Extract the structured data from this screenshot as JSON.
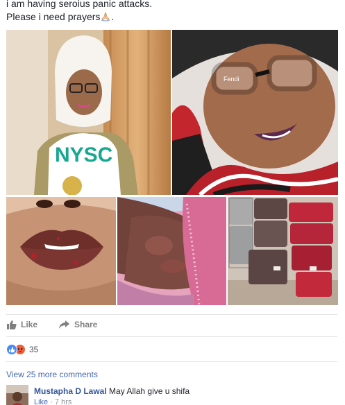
{
  "post": {
    "line1": "i am having seroius panic attacks.",
    "line2": "Please i need prayers",
    "line2_suffix": "."
  },
  "photos": [
    {
      "name": "nysc-portrait",
      "shirt_text": "NYSC"
    },
    {
      "name": "hijab-selfie",
      "glasses_brand": "Fendi"
    },
    {
      "name": "injured-lips"
    },
    {
      "name": "neck-burns"
    },
    {
      "name": "luggage-pile"
    }
  ],
  "actions": {
    "like_label": "Like",
    "share_label": "Share"
  },
  "reactions": {
    "count": "35",
    "types": [
      "like",
      "angry"
    ]
  },
  "comments_section": {
    "more_label": "View 25 more comments",
    "items": [
      {
        "author": "Mustapha D Lawal",
        "text": "May Allah give u shifa",
        "like_label": "Like",
        "separator": " · ",
        "time": "7 hrs"
      }
    ]
  },
  "colors": {
    "link": "#4267b2",
    "author": "#365899",
    "muted": "#7f7f7f",
    "like_reaction": "#4a8af4",
    "angry_reaction": "#f05e3b"
  },
  "icons": [
    "folded-hands-emoji",
    "thumbs-up-icon",
    "share-arrow-icon",
    "like-reaction-icon",
    "angry-reaction-icon"
  ]
}
